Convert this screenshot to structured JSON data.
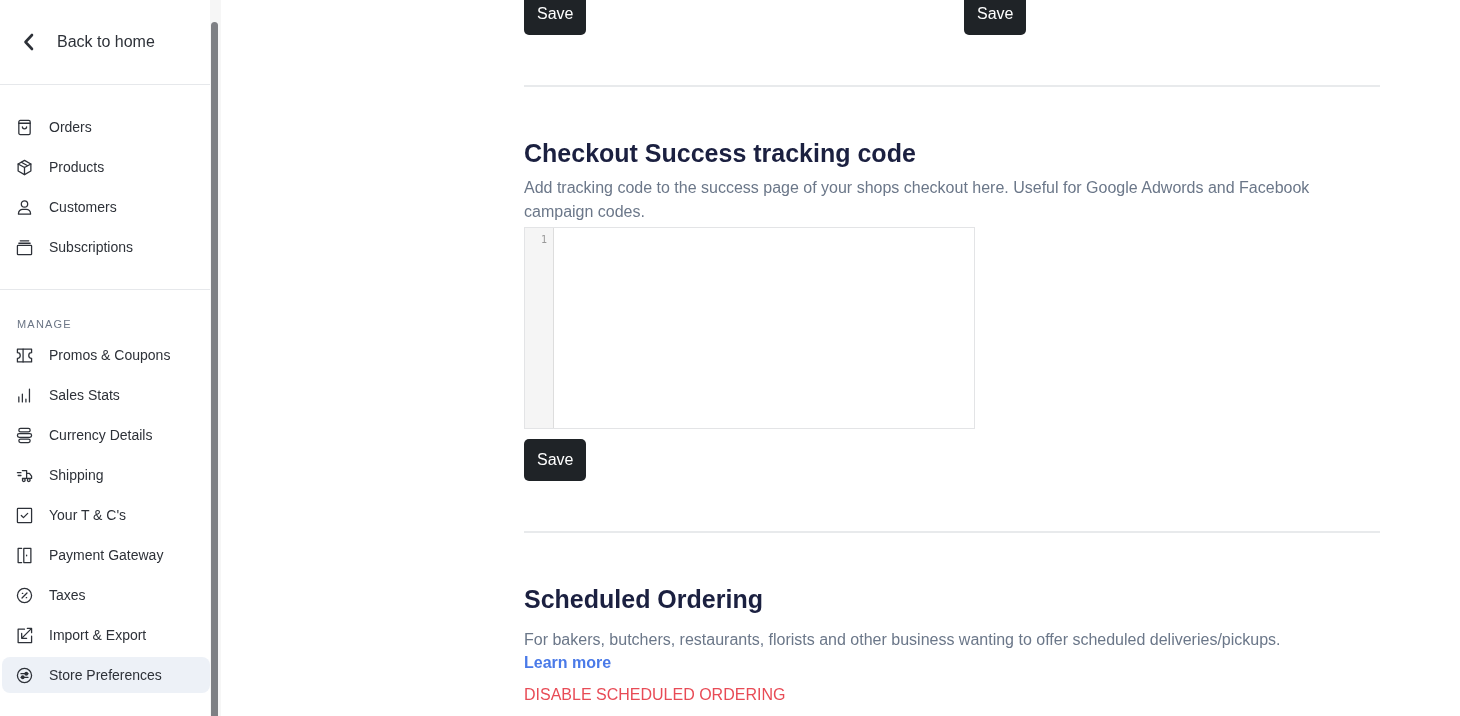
{
  "sidebar": {
    "back_link": "Back to home",
    "groups": [
      {
        "items": [
          {
            "label": "Orders",
            "selected": false
          },
          {
            "label": "Products",
            "selected": false
          },
          {
            "label": "Customers",
            "selected": false
          },
          {
            "label": "Subscriptions",
            "selected": false
          }
        ]
      },
      {
        "heading": "MANAGE",
        "items": [
          {
            "label": "Promos & Coupons",
            "selected": false
          },
          {
            "label": "Sales Stats",
            "selected": false
          },
          {
            "label": "Currency Details",
            "selected": false
          },
          {
            "label": "Shipping",
            "selected": false
          },
          {
            "label": "Your T & C's",
            "selected": false
          },
          {
            "label": "Payment Gateway",
            "selected": false
          },
          {
            "label": "Taxes",
            "selected": false
          },
          {
            "label": "Import & Export",
            "selected": false
          },
          {
            "label": "Store Preferences",
            "selected": true
          }
        ]
      }
    ]
  },
  "main": {
    "top_buttons": [
      "Save",
      "Save"
    ],
    "sections": [
      {
        "kind": "code",
        "title": "Checkout Success tracking code",
        "description": "Add tracking code to the success page of your shops checkout here. Useful for Google Adwords and Facebook campaign codes.",
        "editor": {
          "line_numbers": [
            "1"
          ]
        },
        "button": "Save"
      },
      {
        "kind": "feature",
        "title": "Scheduled Ordering",
        "description": "For bakers, butchers, restaurants, florists and other business wanting to offer scheduled deliveries/pickups.",
        "link": "Learn more",
        "danger_action": "DISABLE SCHEDULED ORDERING"
      }
    ]
  }
}
